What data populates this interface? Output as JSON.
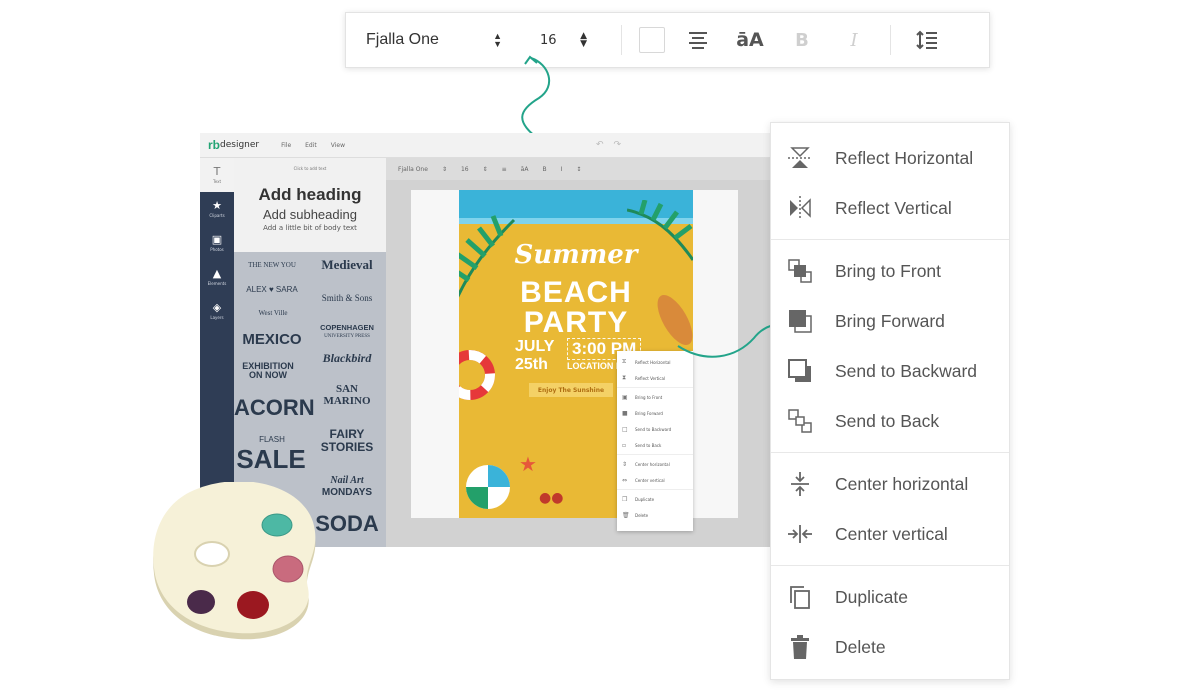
{
  "toolbar": {
    "font_name": "Fjalla One",
    "font_size": "16",
    "align_icon": "align-center-icon",
    "case_label": "āA",
    "bold_label": "B",
    "italic_label": "I",
    "line_height_icon": "line-height-icon"
  },
  "app": {
    "logo_mark": "rb",
    "logo_text": "designer",
    "menu": [
      "File",
      "Edit",
      "View"
    ],
    "rail": [
      {
        "label": "Text",
        "icon": "text-icon",
        "glyph": "T"
      },
      {
        "label": "Cliparts",
        "icon": "star-icon",
        "glyph": "★"
      },
      {
        "label": "Photos",
        "icon": "image-icon",
        "glyph": "▣"
      },
      {
        "label": "Elements",
        "icon": "shapes-icon",
        "glyph": "▲"
      },
      {
        "label": "Layers",
        "icon": "layers-icon",
        "glyph": "◈"
      }
    ],
    "panel": {
      "hint": "Click to add text",
      "heading": "Add heading",
      "subheading": "Add subheading",
      "body": "Add a little bit of body text"
    },
    "thumbs": {
      "the_new_you": "THE NEW YOU",
      "medieval": "Medieval",
      "alex_sara": "ALEX ♥ SARA",
      "smith_sons": "Smith & Sons",
      "west_ville": "West  Ville",
      "copenhagen": "COPENHAGEN",
      "university_press": "UNIVERSITY PRESS",
      "mexico": "MEXICO",
      "blackbird": "Blackbird",
      "exhibition": "EXHIBITION ON NOW",
      "san_marino": "SAN MARINO",
      "acorn": "ACORN",
      "fairy_stories": "FAIRY STORIES",
      "flash": "FLASH",
      "sale": "SALE",
      "nail_art": "Nail Art",
      "mondays": "MONDAYS",
      "soda": "SODA"
    },
    "canvas_font": "Fjalla One",
    "canvas_size": "16",
    "poster": {
      "summer": "Summer",
      "beach": "BEACH",
      "party": "PARTY",
      "date_line1": "JULY",
      "date_line2": "25th",
      "time": "3:00 PM",
      "location": "LOCATION NAME",
      "button": "Enjoy The Sunshine"
    },
    "mini_menu": [
      "Reflect Horizontal",
      "Reflect Vertical",
      "-",
      "Bring to Front",
      "Bring Forward",
      "Send to Backward",
      "Send to Back",
      "-",
      "Center horizontal",
      "Center vertical",
      "-",
      "Duplicate",
      "Delete"
    ]
  },
  "context_menu": {
    "groups": [
      [
        {
          "label": "Reflect Horizontal",
          "icon": "reflect-horizontal-icon"
        },
        {
          "label": "Reflect Vertical",
          "icon": "reflect-vertical-icon"
        }
      ],
      [
        {
          "label": "Bring to Front",
          "icon": "bring-to-front-icon"
        },
        {
          "label": "Bring Forward",
          "icon": "bring-forward-icon"
        },
        {
          "label": "Send to Backward",
          "icon": "send-backward-icon"
        },
        {
          "label": "Send to Back",
          "icon": "send-to-back-icon"
        }
      ],
      [
        {
          "label": "Center horizontal",
          "icon": "center-horizontal-icon"
        },
        {
          "label": "Center vertical",
          "icon": "center-vertical-icon"
        }
      ],
      [
        {
          "label": "Duplicate",
          "icon": "duplicate-icon"
        },
        {
          "label": "Delete",
          "icon": "trash-icon"
        }
      ]
    ]
  },
  "colors": {
    "accent_teal": "#23a48a",
    "rail": "#2f3d55",
    "poster_yellow": "#e9b935",
    "palette_body": "#f6f1d8"
  }
}
